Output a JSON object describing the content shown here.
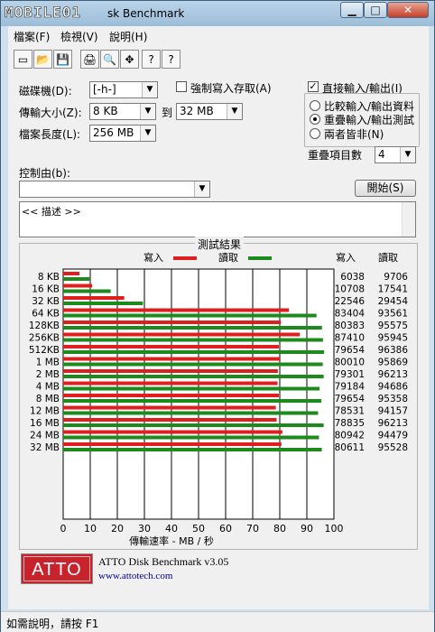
{
  "window": {
    "logo_text": "MOBILE01",
    "title": "sk Benchmark"
  },
  "menu": {
    "items": [
      "檔案(F)",
      "檢視(V)",
      "說明(H)"
    ]
  },
  "toolbar": {
    "icons": [
      "new-document-icon",
      "open-folder-icon",
      "save-icon",
      "print-icon",
      "print-preview-icon",
      "move-icon",
      "help-icon",
      "context-help-icon"
    ],
    "glyphs": [
      "▭",
      "📂",
      "💾",
      "🖨",
      "🔍",
      "✥",
      "?",
      "?"
    ]
  },
  "settings": {
    "drive_label": "磁碟機(D):",
    "drive_value": "[-h-]",
    "size_label": "傳輸大小(Z):",
    "size_from": "8 KB",
    "to_label": "到",
    "size_to": "32 MB",
    "length_label": "檔案長度(L):",
    "length_value": "256 MB",
    "force_write_label": "強制寫入存取(A)",
    "direct_io_label": "直接輸入/輸出(I)",
    "direct_io_checked": true,
    "radio_options": [
      "比較輸入/輸出資料",
      "重疊輸入/輸出測試",
      "兩者皆非(N)"
    ],
    "radio_selected": 1,
    "queue_label": "重疊項目數",
    "queue_value": "4",
    "controlled_by_label": "控制由(b):",
    "controlled_by_value": "",
    "start_button": "開始(S)",
    "description": "<< 描述 >>"
  },
  "results": {
    "title": "測試結果",
    "write_legend": "寫入",
    "read_legend": "讀取",
    "write_col": "寫入",
    "read_col": "讀取",
    "xlabel": "傳輸速率 - MB / 秒"
  },
  "colors": {
    "write": "#e01e1e",
    "read": "#1c8b1c",
    "accent": "#c8232c"
  },
  "chart_data": {
    "type": "bar",
    "categories": [
      "8 KB",
      "16 KB",
      "32 KB",
      "64 KB",
      "128KB",
      "256KB",
      "512KB",
      "1 MB",
      "2 MB",
      "4 MB",
      "8 MB",
      "12 MB",
      "16 MB",
      "24 MB",
      "32 MB"
    ],
    "series": [
      {
        "name": "寫入",
        "values": [
          6038,
          10708,
          22546,
          83404,
          80383,
          87410,
          79654,
          80010,
          79301,
          79184,
          79654,
          78531,
          78835,
          80942,
          80611
        ]
      },
      {
        "name": "讀取",
        "values": [
          9706,
          17541,
          29454,
          93561,
          95575,
          95945,
          96386,
          95869,
          96213,
          94686,
          95358,
          94157,
          96213,
          94479,
          95528
        ]
      }
    ],
    "ticks": [
      0,
      10,
      20,
      30,
      40,
      50,
      60,
      70,
      80,
      90,
      100
    ],
    "xlabel": "傳輸速率 - MB / 秒",
    "xlim": [
      0,
      100
    ],
    "grid": true
  },
  "footer": {
    "logo": "ATTO",
    "product": "ATTO Disk Benchmark v3.05",
    "url": "www.attotech.com"
  },
  "status": {
    "text": "如需說明，請按 F1"
  }
}
